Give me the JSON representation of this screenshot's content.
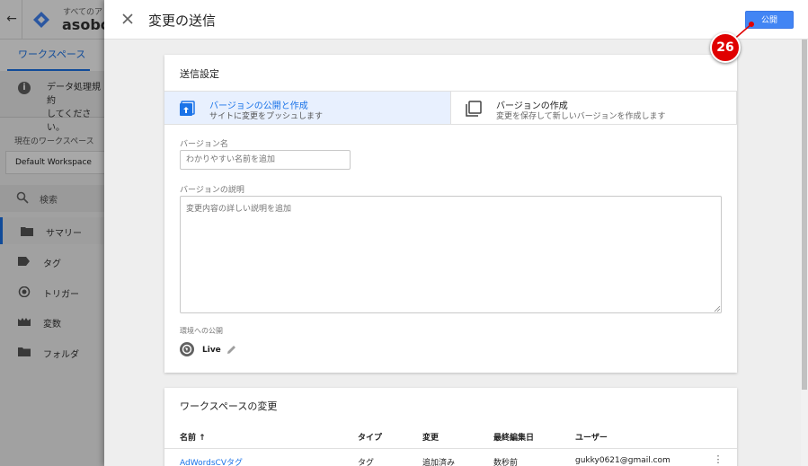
{
  "background": {
    "account_label": "すべてのア",
    "container_name": "asobou",
    "tab_workspace": "ワークスペース",
    "notice_text_line1": "データ処理規約",
    "notice_text_line2": "してください。",
    "workspace_label": "現在のワークスペース",
    "workspace_value": "Default Workspace",
    "search_label": "検索",
    "nav": {
      "summary": "サマリー",
      "tags": "タグ",
      "triggers": "トリガー",
      "variables": "変数",
      "folders": "フォルダ"
    }
  },
  "dialog": {
    "title": "変更の送信",
    "publish_button": "公開",
    "settings": {
      "heading": "送信設定",
      "option_publish": {
        "title": "バージョンの公開と作成",
        "subtitle": "サイトに変更をプッシュします",
        "selected": true
      },
      "option_version": {
        "title": "バージョンの作成",
        "subtitle": "変更を保存して新しいバージョンを作成します",
        "selected": false
      },
      "version_name_label": "バージョン名",
      "version_name_placeholder": "わかりやすい名前を追加",
      "version_name_value": "",
      "version_desc_label": "バージョンの説明",
      "version_desc_placeholder": "変更内容の詳しい説明を追加",
      "version_desc_value": "",
      "environment_label": "環境への公開",
      "environment_name": "Live"
    },
    "changes": {
      "heading": "ワークスペースの変更",
      "columns": {
        "name": "名前 ↑",
        "type": "タイプ",
        "change": "変更",
        "last_edited": "最終編集日",
        "user": "ユーザー"
      },
      "rows": [
        {
          "name": "AdWordsCVタグ",
          "type": "タグ",
          "change": "追加済み",
          "last_edited": "数秒前",
          "user": "gukky0621@gmail.com"
        }
      ]
    }
  },
  "callout": {
    "number": "26",
    "color": "#e00000"
  },
  "colors": {
    "accent": "#1a73e8",
    "publish_button": "#4285f4",
    "selected_option_bg": "#e8f0fe"
  }
}
